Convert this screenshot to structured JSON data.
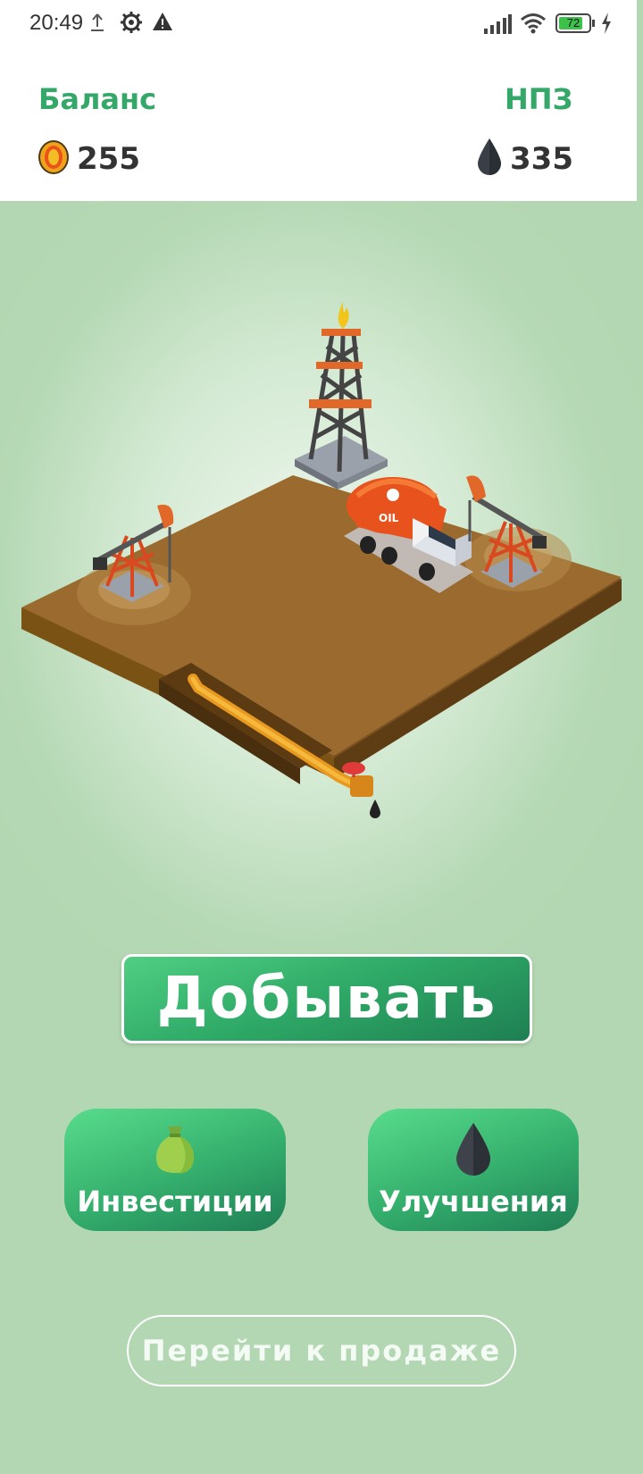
{
  "status_bar": {
    "time": "20:49",
    "battery": "72"
  },
  "header": {
    "balance_label": "Баланс",
    "balance_value": "255",
    "npz_label": "НПЗ",
    "oil_value": "335"
  },
  "scene": {
    "truck_text": "OIL"
  },
  "actions": {
    "mine_label": "Добывать",
    "invest_label": "Инвестиции",
    "upgrade_label": "Улучшения",
    "sell_label": "Перейти к продаже"
  },
  "colors": {
    "accent_green": "#35a869",
    "background": "#b3d7b2",
    "ground": "#9a6a2e"
  },
  "icons": [
    "upload-icon",
    "settings-icon",
    "warning-icon",
    "signal-icon",
    "wifi-icon",
    "battery-icon",
    "charging-icon",
    "coin-icon",
    "oil-drop-icon",
    "money-bag-icon"
  ]
}
